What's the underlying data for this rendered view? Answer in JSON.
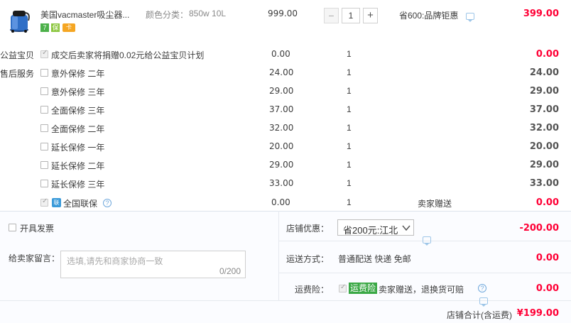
{
  "product": {
    "title": "美国vacmaster吸尘器...",
    "sku_label": "颜色分类：",
    "sku_value": "850w 10L",
    "unit_price": "999.00",
    "quantity": "1",
    "minus_symbol": "−",
    "plus_symbol": "+",
    "promotion": "省600:品牌钜惠",
    "subtotal": "399.00",
    "badges": [
      "7",
      "保",
      "卡"
    ]
  },
  "charity": {
    "section_label": "公益宝贝",
    "text": "成交后卖家将捐赠0.02元给公益宝贝计划",
    "price": "0.00",
    "qty": "1",
    "subtotal": "0.00"
  },
  "services": {
    "section_label": "售后服务",
    "items": [
      {
        "name": "意外保修 二年",
        "price": "24.00",
        "qty": "1",
        "subtotal": "24.00"
      },
      {
        "name": "意外保修 三年",
        "price": "29.00",
        "qty": "1",
        "subtotal": "29.00"
      },
      {
        "name": "全面保修 三年",
        "price": "37.00",
        "qty": "1",
        "subtotal": "37.00"
      },
      {
        "name": "全面保修 二年",
        "price": "32.00",
        "qty": "1",
        "subtotal": "32.00"
      },
      {
        "name": "延长保修 一年",
        "price": "20.00",
        "qty": "1",
        "subtotal": "20.00"
      },
      {
        "name": "延长保修 二年",
        "price": "29.00",
        "qty": "1",
        "subtotal": "29.00"
      },
      {
        "name": "延长保修 三年",
        "price": "33.00",
        "qty": "1",
        "subtotal": "33.00"
      }
    ],
    "warranty": {
      "badge": "联",
      "name": "全国联保",
      "help": "?",
      "price": "0.00",
      "qty": "1",
      "note": "卖家赠送",
      "subtotal": "0.00"
    }
  },
  "invoice": {
    "label": "开具发票"
  },
  "message": {
    "label": "给卖家留言：",
    "placeholder": "选填,请先和商家协商一致",
    "counter": "0/200"
  },
  "shop_discount": {
    "label": "店铺优惠：",
    "selected": "省200元:江北",
    "value": "-200.00"
  },
  "shipping": {
    "label": "运送方式：",
    "text": "普通配送 快递 免邮",
    "value": "0.00"
  },
  "insurance": {
    "label": "运费险：",
    "badge": "运费险",
    "text": "卖家赠送，退换货可赔",
    "help": "?",
    "value": "0.00"
  },
  "total": {
    "label": "店铺合计(含运费)",
    "value": "¥199.00"
  },
  "colors": {
    "accent_red": "#ff0036",
    "insurance_green": "#3aa845",
    "link_blue": "#6fa8dc"
  }
}
